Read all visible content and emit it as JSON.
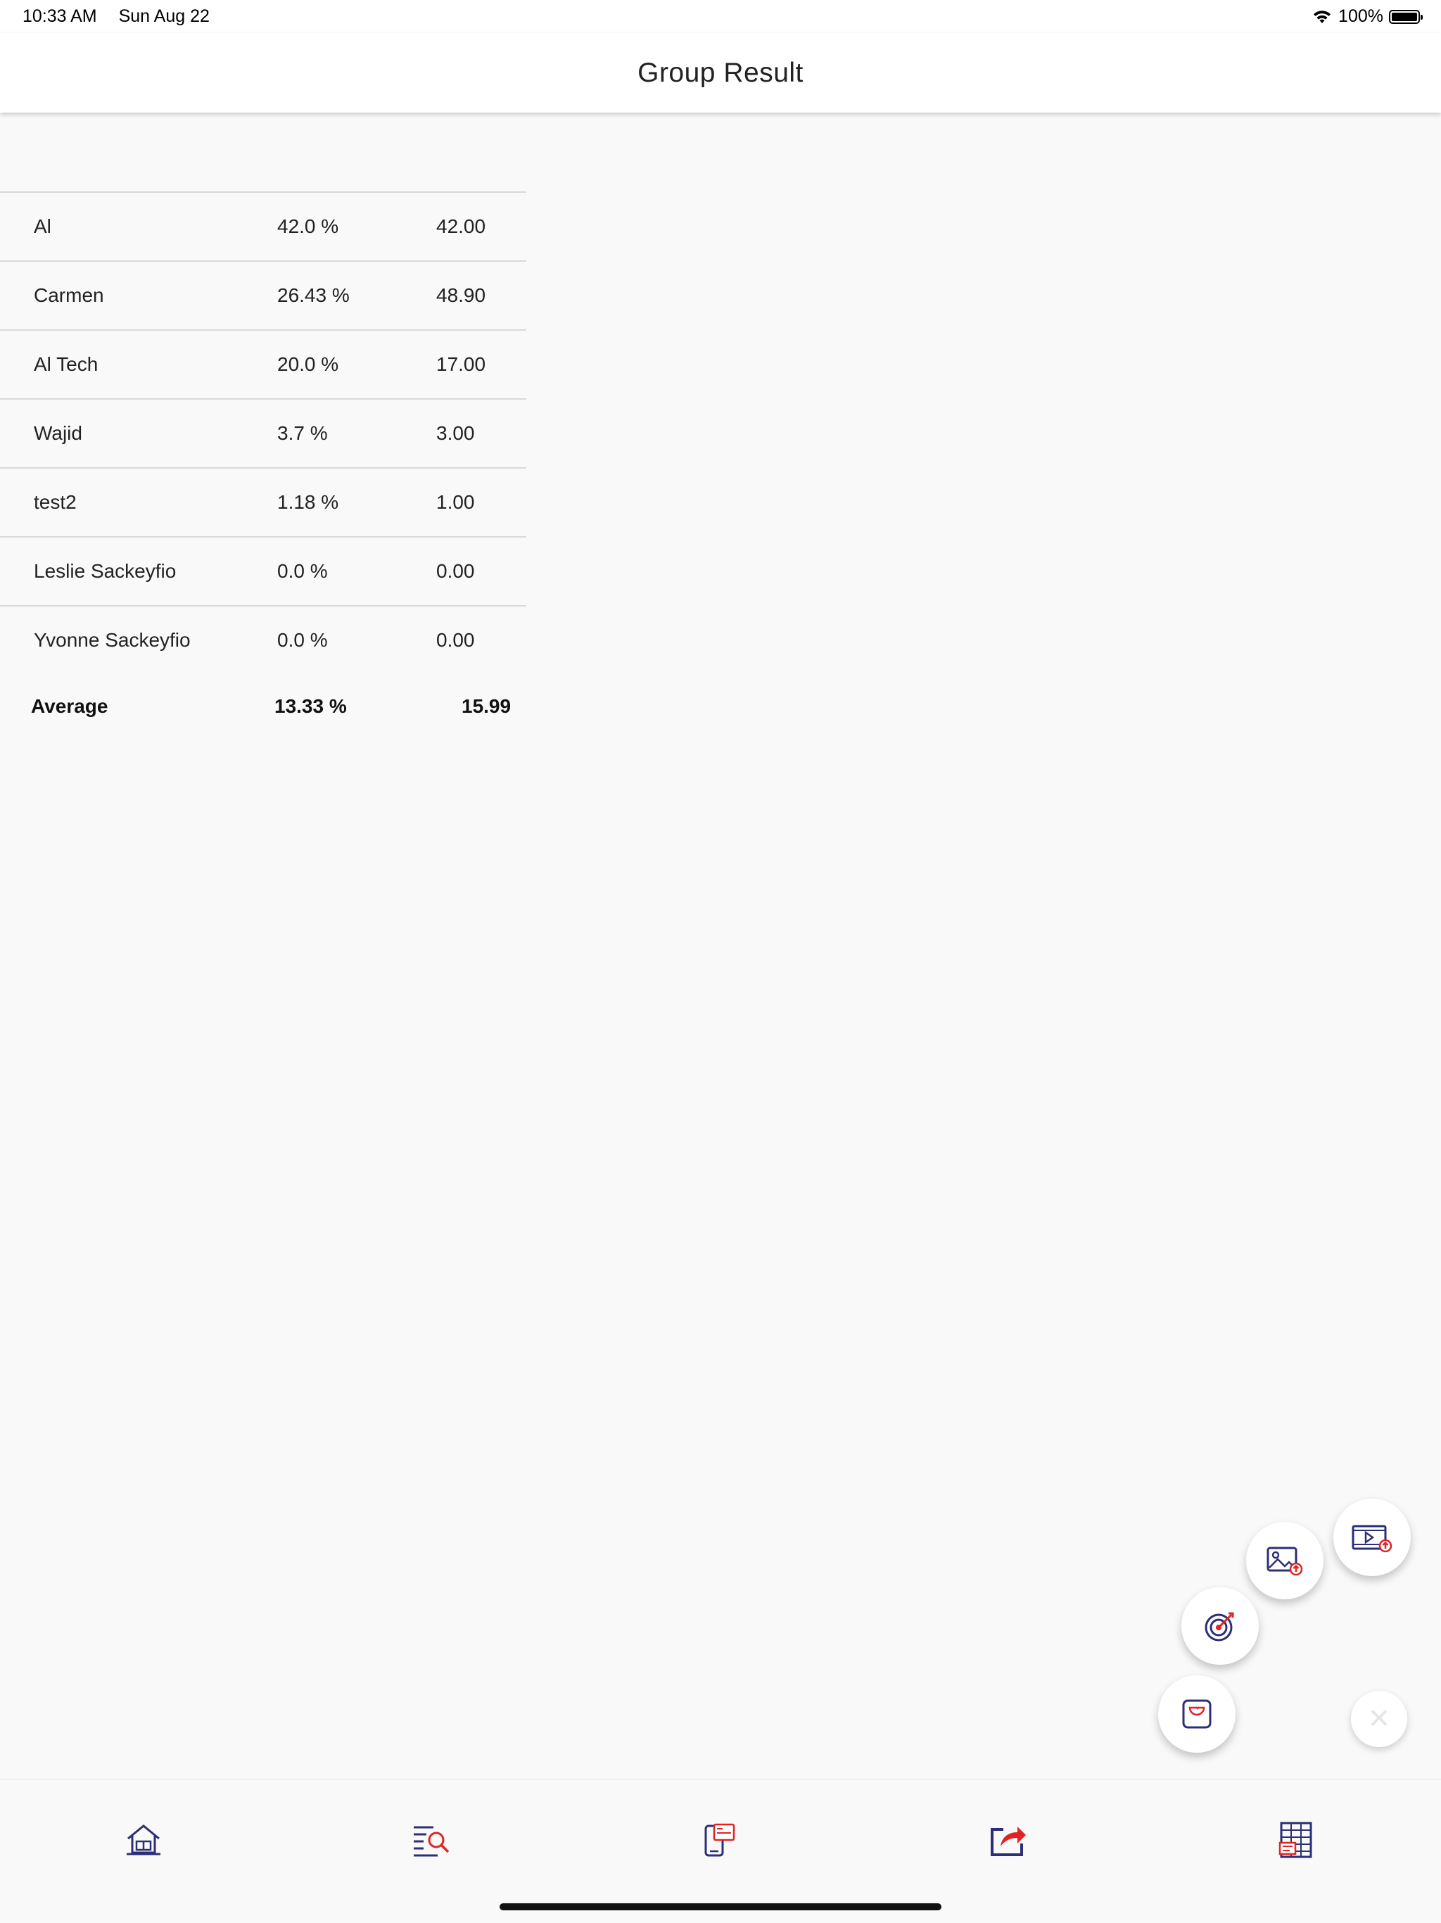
{
  "status_bar": {
    "time": "10:33 AM",
    "date": "Sun Aug 22",
    "battery": "100%",
    "battery_level": 1.0
  },
  "header": {
    "title": "Group Result"
  },
  "results": {
    "rows": [
      {
        "name": "Al",
        "percent": "42.0 %",
        "value": "42.00"
      },
      {
        "name": "Carmen",
        "percent": "26.43 %",
        "value": "48.90"
      },
      {
        "name": "Al Tech",
        "percent": "20.0 %",
        "value": "17.00"
      },
      {
        "name": "Wajid",
        "percent": "3.7 %",
        "value": "3.00"
      },
      {
        "name": "test2",
        "percent": "1.18 %",
        "value": "1.00"
      },
      {
        "name": "Leslie Sackeyfio",
        "percent": "0.0 %",
        "value": "0.00"
      },
      {
        "name": "Yvonne Sackeyfio",
        "percent": "0.0 %",
        "value": "0.00"
      }
    ],
    "average": {
      "label": "Average",
      "percent": "13.33 %",
      "value": "15.99"
    }
  },
  "fab_menu": {
    "items": [
      "video-upload-icon",
      "image-upload-icon",
      "target-icon",
      "scale-icon"
    ],
    "close_icon": "close-icon"
  },
  "tab_bar": {
    "icons": [
      "home-icon",
      "search-list-icon",
      "payment-icon",
      "share-icon",
      "spreadsheet-icon"
    ]
  },
  "colors": {
    "icon_primary": "#2b2f77",
    "icon_accent": "#e02424",
    "background": "#f9f9f9"
  }
}
